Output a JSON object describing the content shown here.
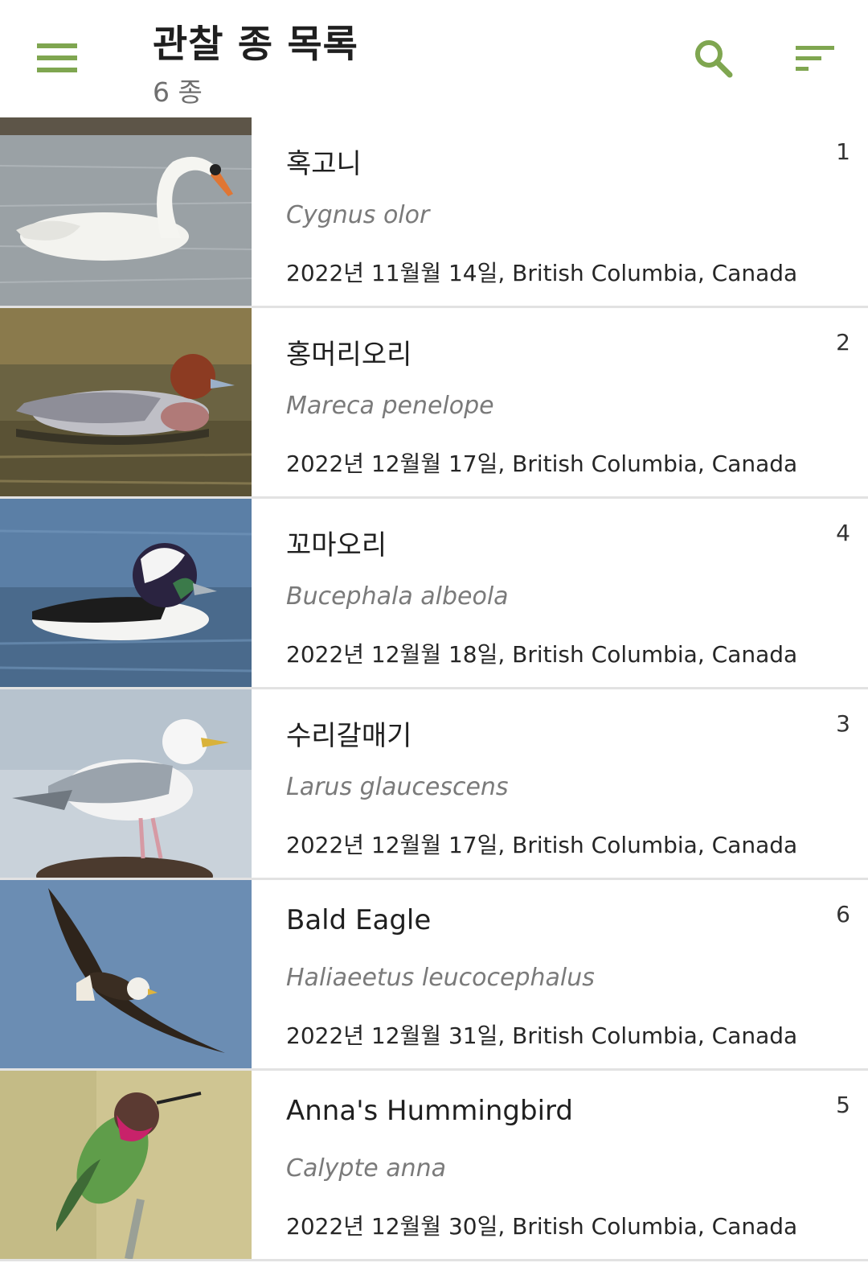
{
  "header": {
    "title": "관찰 종 목록",
    "subtitle": "6 종",
    "accent_color": "#7fa650",
    "icons": [
      "menu-icon",
      "search-icon",
      "sort-icon"
    ]
  },
  "species": [
    {
      "common_name": "혹고니",
      "scientific_name": "Cygnus olor",
      "observed": "2022년 11월월 14일, British Columbia, Canada",
      "count": "1"
    },
    {
      "common_name": "홍머리오리",
      "scientific_name": "Mareca penelope",
      "observed": "2022년 12월월 17일, British Columbia, Canada",
      "count": "2"
    },
    {
      "common_name": "꼬마오리",
      "scientific_name": "Bucephala albeola",
      "observed": "2022년 12월월 18일, British Columbia, Canada",
      "count": "4"
    },
    {
      "common_name": "수리갈매기",
      "scientific_name": "Larus glaucescens",
      "observed": "2022년 12월월 17일, British Columbia, Canada",
      "count": "3"
    },
    {
      "common_name": "Bald Eagle",
      "scientific_name": "Haliaeetus leucocephalus",
      "observed": "2022년 12월월 31일, British Columbia, Canada",
      "count": "6"
    },
    {
      "common_name": "Anna's Hummingbird",
      "scientific_name": "Calypte anna",
      "observed": "2022년 12월월 30일, British Columbia, Canada",
      "count": "5"
    }
  ]
}
